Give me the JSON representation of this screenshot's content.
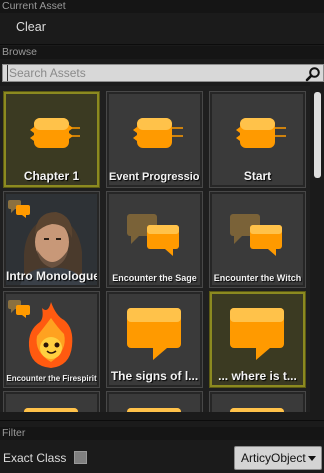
{
  "current_asset": {
    "label": "Current Asset",
    "value": "Clear"
  },
  "browse": {
    "label": "Browse",
    "search_placeholder": "Search Assets"
  },
  "tiles": [
    {
      "caption": "Chapter 1",
      "kind": "flow-node",
      "selected": true
    },
    {
      "caption": "Event Progression",
      "kind": "flow-node",
      "selected": false
    },
    {
      "caption": "Start",
      "kind": "flow-node",
      "selected": false
    },
    {
      "caption": "Intro Monologue",
      "kind": "portrait-man",
      "selected": false
    },
    {
      "caption": "Encounter the Sage",
      "kind": "dialogue-bubbles",
      "selected": false
    },
    {
      "caption": "Encounter the Witch",
      "kind": "dialogue-bubbles",
      "selected": false
    },
    {
      "caption": "Encounter the Firespirit",
      "kind": "portrait-fire-spirit",
      "selected": false
    },
    {
      "caption": "The signs of l...",
      "kind": "speech-bubble",
      "selected": false
    },
    {
      "caption": "... where is t...",
      "kind": "speech-bubble",
      "selected": true
    }
  ],
  "filter": {
    "label": "Filter",
    "exact_class_label": "Exact Class",
    "exact_class_checked": false,
    "class_value": "ArticyObject"
  },
  "colors": {
    "accent_orange": "#ff9a00",
    "selected_border": "#8c8a20"
  }
}
